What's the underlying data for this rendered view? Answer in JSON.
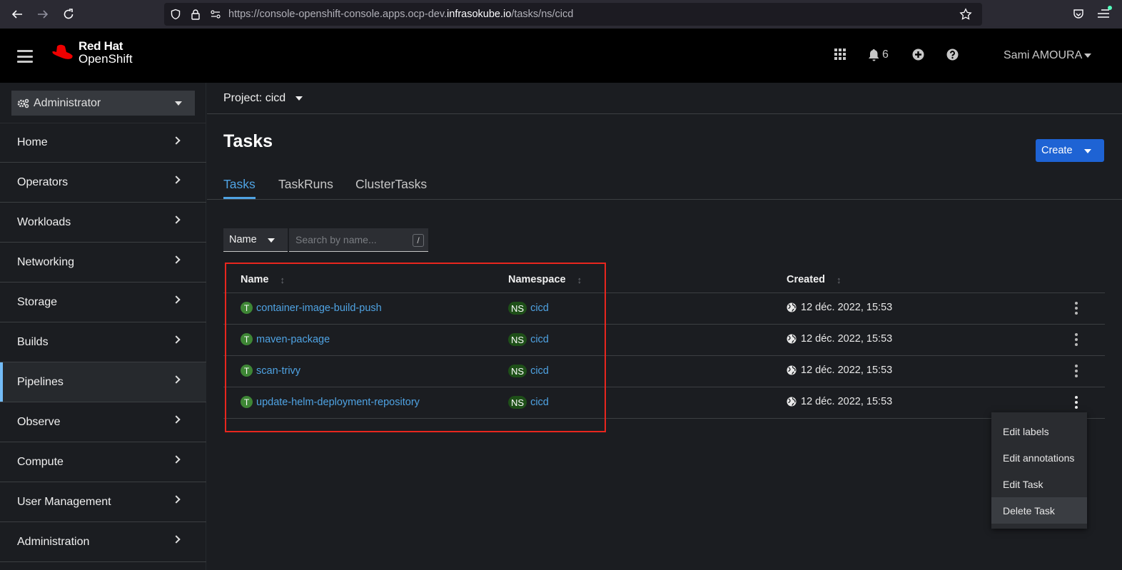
{
  "browser": {
    "url_prefix": "https://console-openshift-console.apps.ocp-dev.",
    "url_domain": "infrasokube.io",
    "url_path": "/tasks/ns/cicd"
  },
  "masthead": {
    "brand_line1": "Red Hat",
    "brand_line2": "OpenShift",
    "notifications_count": "6",
    "user_name": "Sami AMOURA"
  },
  "sidebar": {
    "perspective": "Administrator",
    "items": [
      {
        "label": "Home"
      },
      {
        "label": "Operators"
      },
      {
        "label": "Workloads"
      },
      {
        "label": "Networking"
      },
      {
        "label": "Storage"
      },
      {
        "label": "Builds"
      },
      {
        "label": "Pipelines",
        "active": true
      },
      {
        "label": "Observe"
      },
      {
        "label": "Compute"
      },
      {
        "label": "User Management"
      },
      {
        "label": "Administration"
      }
    ]
  },
  "main": {
    "project_label": "Project: cicd",
    "title": "Tasks",
    "create_label": "Create",
    "tabs": [
      {
        "label": "Tasks",
        "active": true
      },
      {
        "label": "TaskRuns"
      },
      {
        "label": "ClusterTasks"
      }
    ],
    "filter": {
      "type": "Name",
      "placeholder": "Search by name...",
      "shortcut": "/"
    },
    "table": {
      "headers": {
        "name": "Name",
        "namespace": "Namespace",
        "created": "Created"
      },
      "rows": [
        {
          "badge": "T",
          "name": "container-image-build-push",
          "ns_badge": "NS",
          "namespace": "cicd",
          "created": "12 déc. 2022, 15:53"
        },
        {
          "badge": "T",
          "name": "maven-package",
          "ns_badge": "NS",
          "namespace": "cicd",
          "created": "12 déc. 2022, 15:53"
        },
        {
          "badge": "T",
          "name": "scan-trivy",
          "ns_badge": "NS",
          "namespace": "cicd",
          "created": "12 déc. 2022, 15:53"
        },
        {
          "badge": "T",
          "name": "update-helm-deployment-repository",
          "ns_badge": "NS",
          "namespace": "cicd",
          "created": "12 déc. 2022, 15:53"
        }
      ]
    },
    "row_menu": {
      "items": [
        "Edit labels",
        "Edit annotations",
        "Edit Task",
        "Delete Task"
      ],
      "hovered": "Delete Task"
    }
  },
  "colors": {
    "accent": "#1e63d4",
    "link": "#4fa3e3",
    "task_badge": "#3e8635",
    "annotation": "#e8261e"
  }
}
